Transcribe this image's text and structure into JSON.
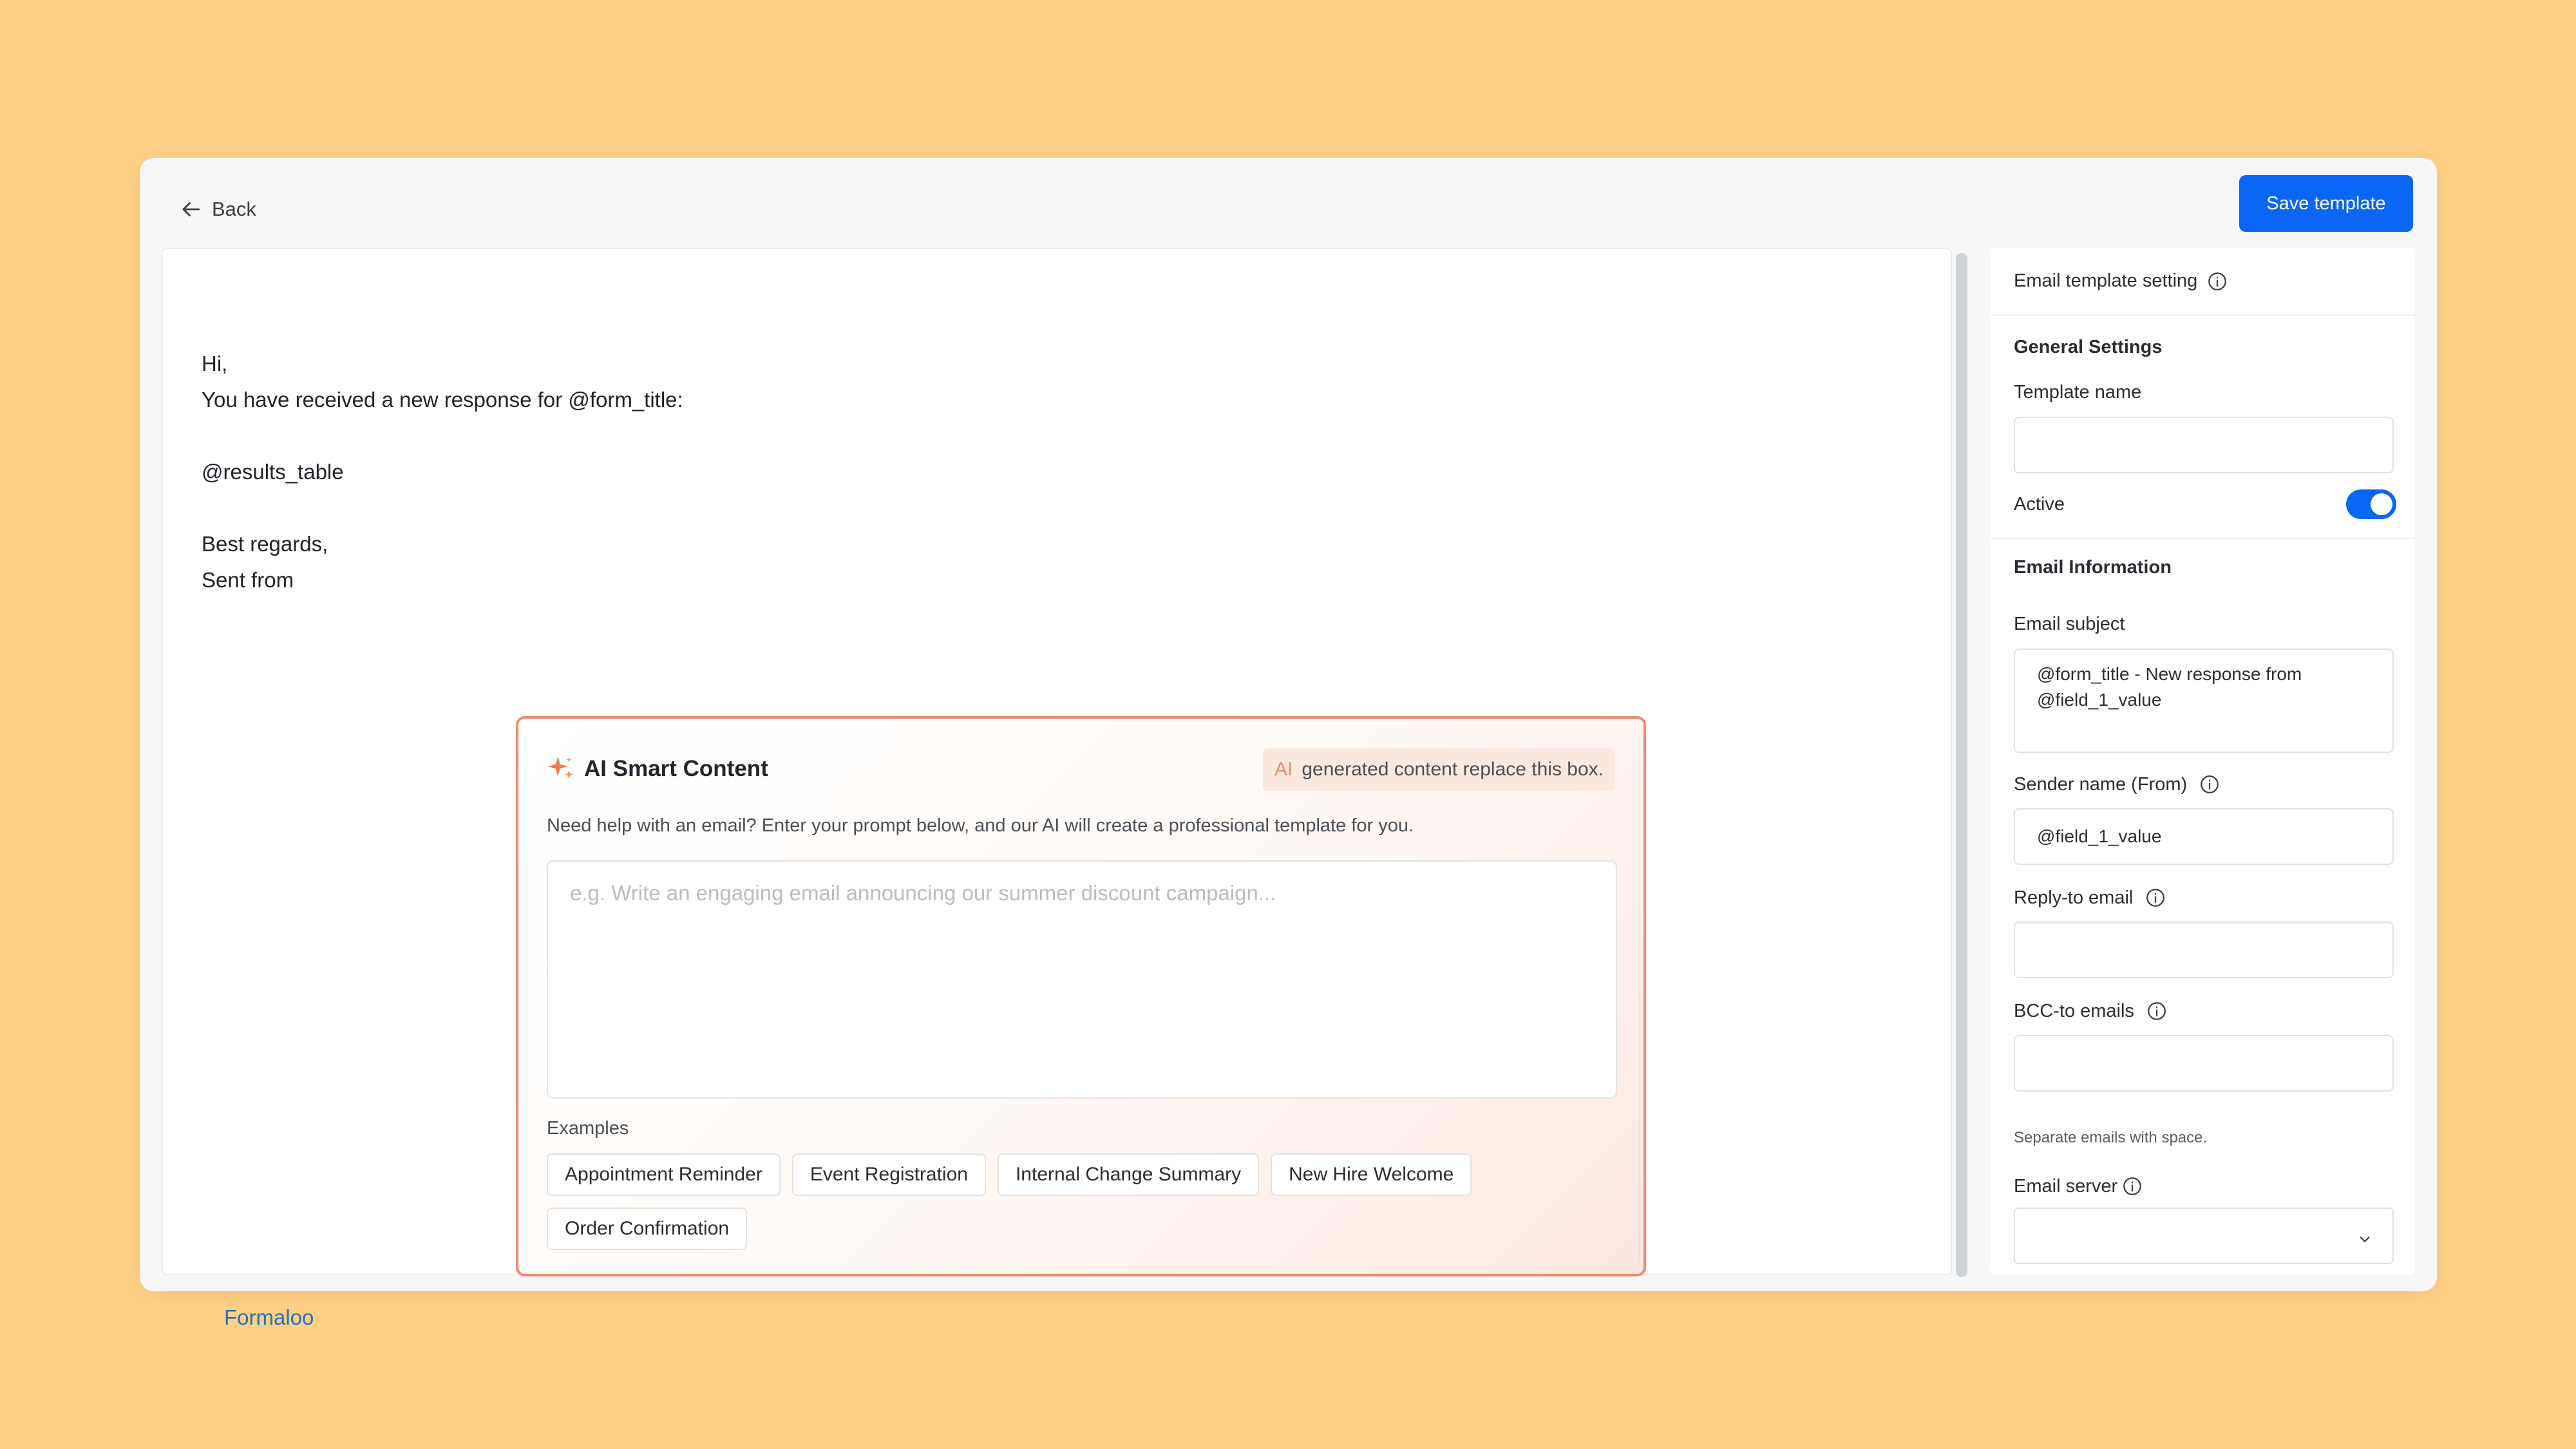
{
  "header": {
    "back_label": "Back",
    "save_label": "Save template"
  },
  "editor": {
    "lines": [
      "Hi,",
      "You have received a new response for @form_title:",
      "",
      "@results_table",
      "",
      "Best regards,",
      "Sent from"
    ],
    "footer_link": "Formaloo"
  },
  "ai_box": {
    "title": "AI Smart Content",
    "badge_ai": "AI",
    "badge_text": "generated content replace this box.",
    "description": "Need help with an email? Enter your prompt below, and our AI will create a professional template for you.",
    "prompt_placeholder": "e.g. Write an engaging email announcing our summer discount campaign...",
    "examples_label": "Examples",
    "examples": [
      "Appointment Reminder",
      "Event Registration",
      "Internal Change Summary",
      "New Hire Welcome",
      "Order Confirmation"
    ]
  },
  "panel": {
    "header": "Email template setting",
    "general_settings": "General Settings",
    "template_name_label": "Template name",
    "template_name_value": "",
    "active_label": "Active",
    "active": true,
    "email_information": "Email Information",
    "email_subject_label": "Email subject",
    "email_subject_value": "@form_title - New response from @field_1_value",
    "sender_name_label": "Sender name (From)",
    "sender_name_value": "@field_1_value",
    "reply_to_label": "Reply-to email",
    "reply_to_value": "",
    "bcc_label": "BCC-to emails",
    "bcc_value": "",
    "bcc_hint": "Separate emails with space.",
    "email_server_label": "Email server",
    "email_server_value": ""
  },
  "colors": {
    "background": "#FED086",
    "primary": "#0a66f5",
    "ai_accent": "#ef8a6a",
    "link": "#2a6fb6"
  }
}
